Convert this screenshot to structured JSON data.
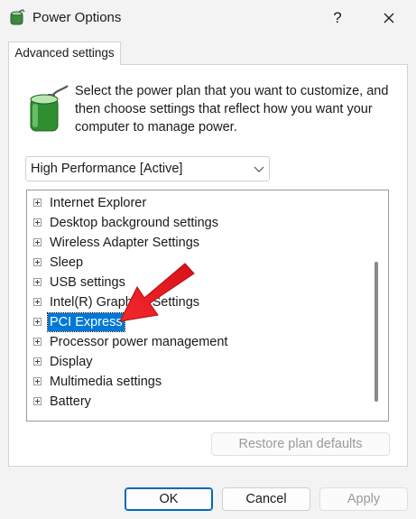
{
  "window": {
    "title": "Power Options",
    "help_label": "?"
  },
  "tab": {
    "label": "Advanced settings"
  },
  "description": "Select the power plan that you want to customize, and then choose settings that reflect how you want your computer to manage power.",
  "plan_select": {
    "value": "High Performance [Active]"
  },
  "tree": {
    "items": [
      {
        "label": "Internet Explorer",
        "selected": false
      },
      {
        "label": "Desktop background settings",
        "selected": false
      },
      {
        "label": "Wireless Adapter Settings",
        "selected": false
      },
      {
        "label": "Sleep",
        "selected": false
      },
      {
        "label": "USB settings",
        "selected": false
      },
      {
        "label": "Intel(R) Graphics Settings",
        "selected": false
      },
      {
        "label": "PCI Express",
        "selected": true
      },
      {
        "label": "Processor power management",
        "selected": false
      },
      {
        "label": "Display",
        "selected": false
      },
      {
        "label": "Multimedia settings",
        "selected": false
      },
      {
        "label": "Battery",
        "selected": false
      }
    ]
  },
  "buttons": {
    "restore": "Restore plan defaults",
    "ok": "OK",
    "cancel": "Cancel",
    "apply": "Apply"
  },
  "colors": {
    "selection": "#0078d7",
    "annotation_arrow": "#e8141b"
  },
  "icons": {
    "title": "power-options-icon",
    "help": "help-icon",
    "close": "close-icon",
    "battery": "battery-plug-icon",
    "dropdown": "chevron-down-icon",
    "expand": "expand-plus-icon"
  }
}
